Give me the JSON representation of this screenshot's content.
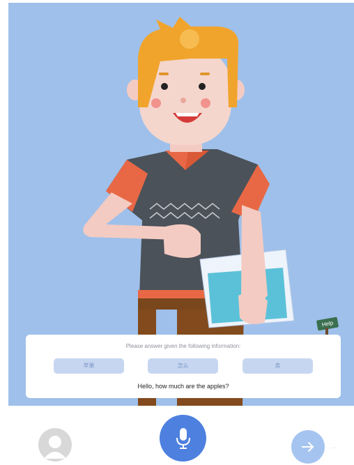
{
  "toolbar": {
    "close_icon": "close-icon"
  },
  "prompt": {
    "instruction": "Please answer given the following information:",
    "choices": [
      "苹果",
      "怎么",
      "卖"
    ],
    "question": "Hello, how much are the apples?"
  },
  "help_sign": {
    "label": "Help"
  },
  "controls": {
    "avatar_icon": "user-avatar-icon",
    "mic_icon": "microphone-icon",
    "next_icon": "arrow-right-icon",
    "more_label": "..."
  },
  "colors": {
    "scene_background": "#9fc0ea",
    "mic_button": "#4e80df",
    "next_button": "#a6c4f0",
    "choice_background": "#c7d6f0"
  }
}
